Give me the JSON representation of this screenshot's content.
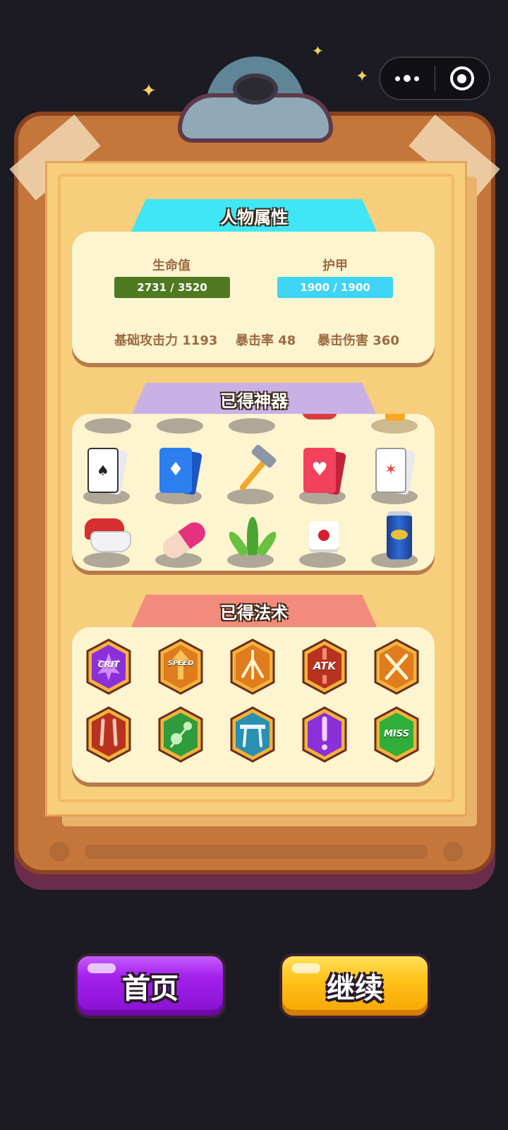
{
  "capsule": {
    "menu_icon": "more-dots-icon",
    "close_icon": "target-circle-icon"
  },
  "attributes": {
    "title": "人物属性",
    "hp": {
      "label": "生命值",
      "text": "2731 / 3520",
      "current": 2731,
      "max": 3520,
      "color": "#4f7a21"
    },
    "armor": {
      "label": "护甲",
      "text": "1900 / 1900",
      "current": 1900,
      "max": 1900,
      "color": "#3fd3f5"
    },
    "attack": "基础攻击力 1193",
    "crit_rate": "暴击率 48",
    "crit_damage": "暴击伤害 360"
  },
  "artifacts": {
    "title": "已得神器",
    "items": [
      "jack-of-spades-cards-icon",
      "blue-diamond-cards-icon",
      "hammer-icon",
      "red-heart-cards-icon",
      "joker-cards-icon",
      "earbuds-case-icon",
      "pill-capsule-icon",
      "aloe-plant-icon",
      "dice-icon",
      "energy-drink-can-icon"
    ]
  },
  "spells": {
    "title": "已得法术",
    "items": [
      {
        "icon": "crit-badge-icon",
        "text": "CRIT"
      },
      {
        "icon": "speed-badge-icon",
        "text": "SPEED"
      },
      {
        "icon": "multishot-badge-icon",
        "text": ""
      },
      {
        "icon": "atk-badge-icon",
        "text": "ATK"
      },
      {
        "icon": "crossed-swords-badge-icon",
        "text": ""
      },
      {
        "icon": "double-claw-badge-icon",
        "text": ""
      },
      {
        "icon": "bounce-skull-badge-icon",
        "text": ""
      },
      {
        "icon": "pierce-badge-icon",
        "text": ""
      },
      {
        "icon": "exclaim-badge-icon",
        "text": ""
      },
      {
        "icon": "miss-badge-icon",
        "text": "MISS"
      }
    ]
  },
  "buttons": {
    "home": "首页",
    "continue": "继续"
  }
}
